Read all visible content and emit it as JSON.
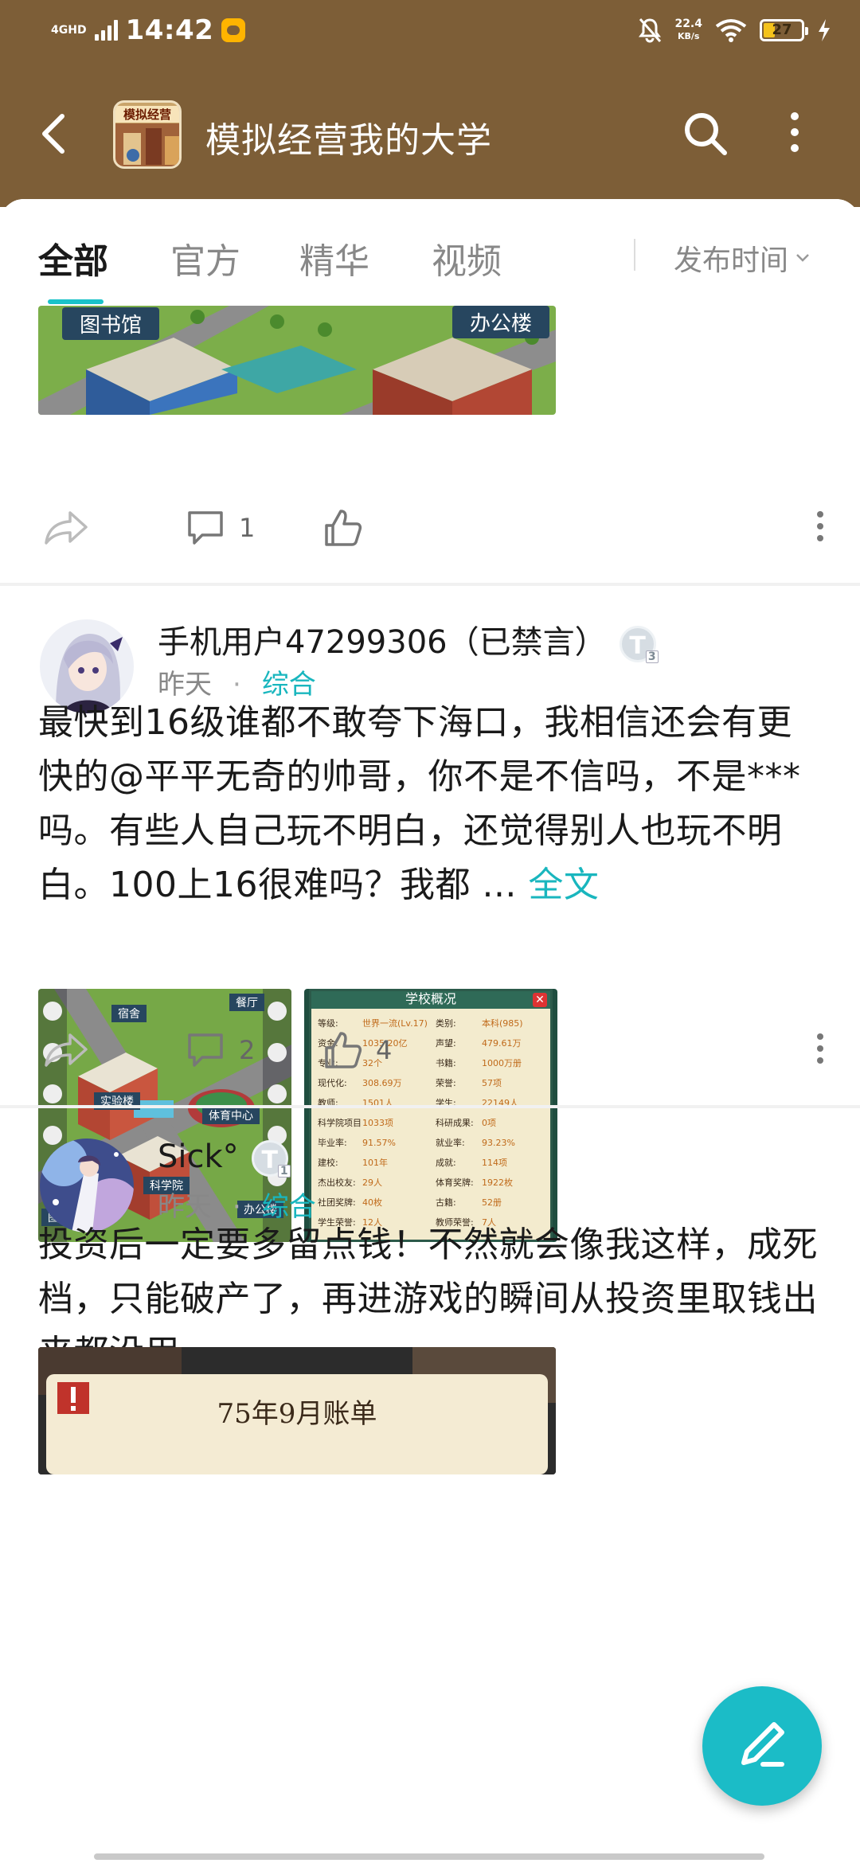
{
  "status_bar": {
    "network": "4GHD",
    "time": "14:42",
    "speed_value": "22.4",
    "speed_unit": "KB/s",
    "battery": "27"
  },
  "nav": {
    "title": "模拟经营我的大学",
    "logo_text": "模拟经营"
  },
  "tabs": {
    "items": [
      {
        "label": "全部"
      },
      {
        "label": "官方"
      },
      {
        "label": "精华"
      },
      {
        "label": "视频"
      }
    ],
    "sort_label": "发布时间"
  },
  "posts": [
    {
      "images": [
        {
          "labels": [
            "图书馆",
            "办公楼"
          ]
        }
      ],
      "comments": "1",
      "likes": ""
    },
    {
      "author": "手机用户47299306（已禁言）",
      "badge": "T",
      "time": "昨天",
      "category": "综合",
      "text": "最快到16级谁都不敢夸下海口，我相信还会有更快的@平平无奇的帅哥，你不是不信吗，不是***吗。有些人自己玩不明白，还觉得别人也玩不明白。100上16很难吗？我都 ...",
      "more_label": "全文",
      "images": [
        {
          "labels": [
            "宿舍",
            "餐厅",
            "实验楼",
            "体育中心",
            "科学院",
            "图书馆",
            "办公楼"
          ]
        },
        {
          "title": "学校概况",
          "stats": [
            [
              "等级:",
              "世界一流(Lv.17)",
              "类别:",
              "本科(985)"
            ],
            [
              "资金:",
              "1035.20亿",
              "声望:",
              "479.61万"
            ],
            [
              "专业:",
              "32个",
              "书籍:",
              "1000万册"
            ],
            [
              "现代化:",
              "308.69万",
              "荣誉:",
              "57项"
            ],
            [
              "教师:",
              "1501人",
              "学生:",
              "22149人"
            ],
            [
              "科学院项目:",
              "1033项",
              "科研成果:",
              "0项"
            ],
            [
              "毕业率:",
              "91.57%",
              "就业率:",
              "93.23%"
            ],
            [
              "建校:",
              "101年",
              "成就:",
              "114项"
            ],
            [
              "杰出校友:",
              "29人",
              "体育奖牌:",
              "1922枚"
            ],
            [
              "社团奖牌:",
              "40枚",
              "古籍:",
              "52册"
            ],
            [
              "学生荣誉:",
              "12人",
              "教师荣誉:",
              "7人"
            ]
          ]
        }
      ],
      "comments": "2",
      "likes": "4"
    },
    {
      "author": "Sick°",
      "badge": "T",
      "time": "昨天",
      "category": "综合",
      "text": "投资后一定要多留点钱！不然就会像我这样，成死档，只能破产了，再进游戏的瞬间从投资里取钱出来都没用",
      "images": [
        {
          "title": "75年9月账单"
        }
      ]
    }
  ],
  "colors": {
    "header_bg": "#7d5e37",
    "accent": "#19b6be",
    "fab": "#1bbcc7"
  },
  "icons": [
    "back-arrow-icon",
    "search-icon",
    "more-vertical-icon",
    "share-icon",
    "comment-icon",
    "like-icon",
    "edit-pen-icon"
  ]
}
